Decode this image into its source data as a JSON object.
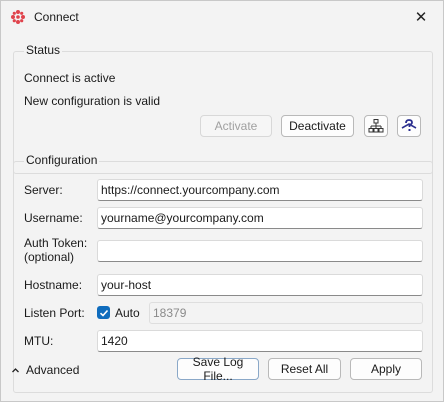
{
  "window": {
    "title": "Connect",
    "close_glyph": "✕",
    "app_icon": "connect-logo-icon"
  },
  "status": {
    "legend": "Status",
    "line1": "Connect is active",
    "line2": "New configuration is valid",
    "activate_label": "Activate",
    "deactivate_label": "Deactivate",
    "network_icon": "network-tree-icon",
    "help_icon": "help-icon"
  },
  "config": {
    "legend": "Configuration",
    "server": {
      "label": "Server:",
      "value": "https://connect.yourcompany.com"
    },
    "username": {
      "label": "Username:",
      "value": "yourname@yourcompany.com"
    },
    "auth_token": {
      "label": "Auth Token:\n(optional)",
      "value": ""
    },
    "hostname": {
      "label": "Hostname:",
      "value": "your-host"
    },
    "listen_port": {
      "label": "Listen Port:",
      "auto_label": "Auto",
      "auto_checked": true,
      "value": "18379"
    },
    "mtu": {
      "label": "MTU:",
      "value": "1420"
    }
  },
  "footer": {
    "advanced_label": "Advanced",
    "save_log_label": "Save Log File...",
    "reset_all_label": "Reset All",
    "apply_label": "Apply"
  },
  "colors": {
    "accent": "#0f6cbd",
    "logo": "#e0434c"
  }
}
